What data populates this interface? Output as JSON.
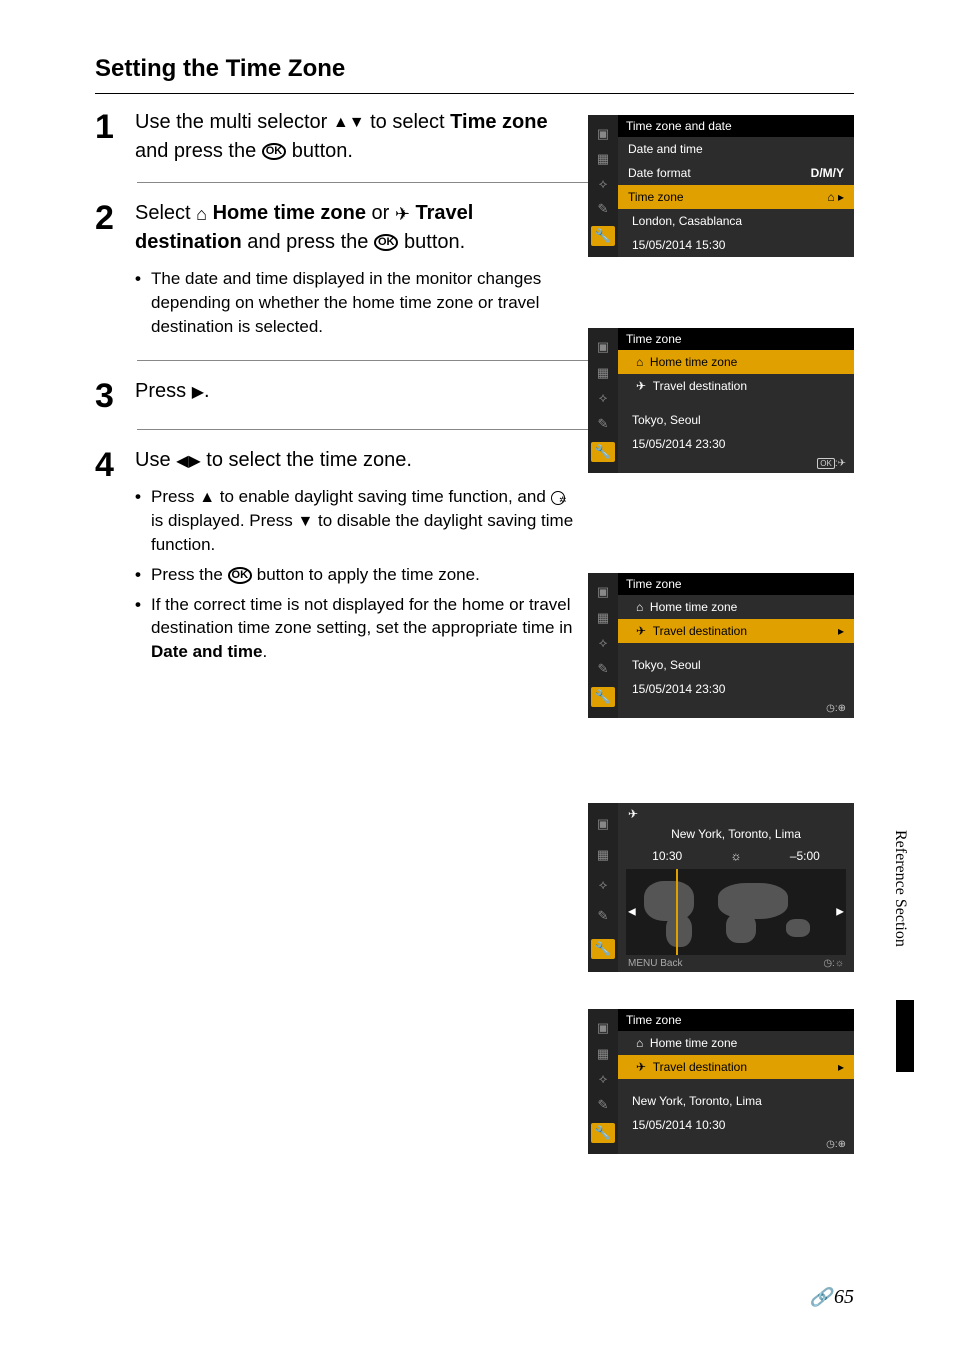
{
  "title": "Setting the Time Zone",
  "side_label": "Reference Section",
  "page_number": "65",
  "steps": {
    "s1": {
      "num": "1",
      "text_a": "Use the multi selector ",
      "text_b": " to select ",
      "bold_a": "Time zone",
      "text_c": " and press the ",
      "text_d": " button."
    },
    "s2": {
      "num": "2",
      "text_a": "Select ",
      "bold_a": " Home time zone",
      "text_b": " or ",
      "bold_b": " Travel destination",
      "text_c": " and press the ",
      "text_d": " button.",
      "bullet1": "The date and time displayed in the monitor changes depending on whether the home time zone or travel destination is selected."
    },
    "s3": {
      "num": "3",
      "text_a": "Press ",
      "text_b": "."
    },
    "s4": {
      "num": "4",
      "text_a": "Use ",
      "text_b": " to select the time zone.",
      "b1a": "Press ",
      "b1b": " to enable daylight saving time function, and ",
      "b1c": " is displayed. Press ",
      "b1d": " to disable the daylight saving time function.",
      "b2a": "Press the ",
      "b2b": " button to apply the time zone.",
      "b3a": "If the correct time is not displayed for the home or travel destination time zone setting, set the appropriate time in ",
      "b3bold": "Date and time",
      "b3b": "."
    }
  },
  "screens": {
    "scr1": {
      "title": "Time zone and date",
      "row1": "Date and time",
      "row2": "Date format",
      "row2v": "D/M/Y",
      "row3": "Time zone",
      "loc": "London, Casablanca",
      "dt": "15/05/2014  15:30"
    },
    "scr2": {
      "title": "Time zone",
      "opt1": "Home time zone",
      "opt2": "Travel destination",
      "loc": "Tokyo, Seoul",
      "dt": "15/05/2014  23:30",
      "foot": ":"
    },
    "scr3": {
      "title": "Time zone",
      "opt1": "Home time zone",
      "opt2": "Travel destination",
      "loc": "Tokyo, Seoul",
      "dt": "15/05/2014  23:30",
      "foot": ":"
    },
    "scr4a": {
      "city": "New York, Toronto, Lima",
      "time": "10:30",
      "offset": "–5:00",
      "back": "Back",
      "foot": ":"
    },
    "scr4b": {
      "title": "Time zone",
      "opt1": "Home time zone",
      "opt2": "Travel destination",
      "loc": "New York, Toronto, Lima",
      "dt": "15/05/2014  10:30",
      "foot": ":"
    }
  },
  "icons": {
    "ok": "OK",
    "menu_back": "MENU"
  }
}
